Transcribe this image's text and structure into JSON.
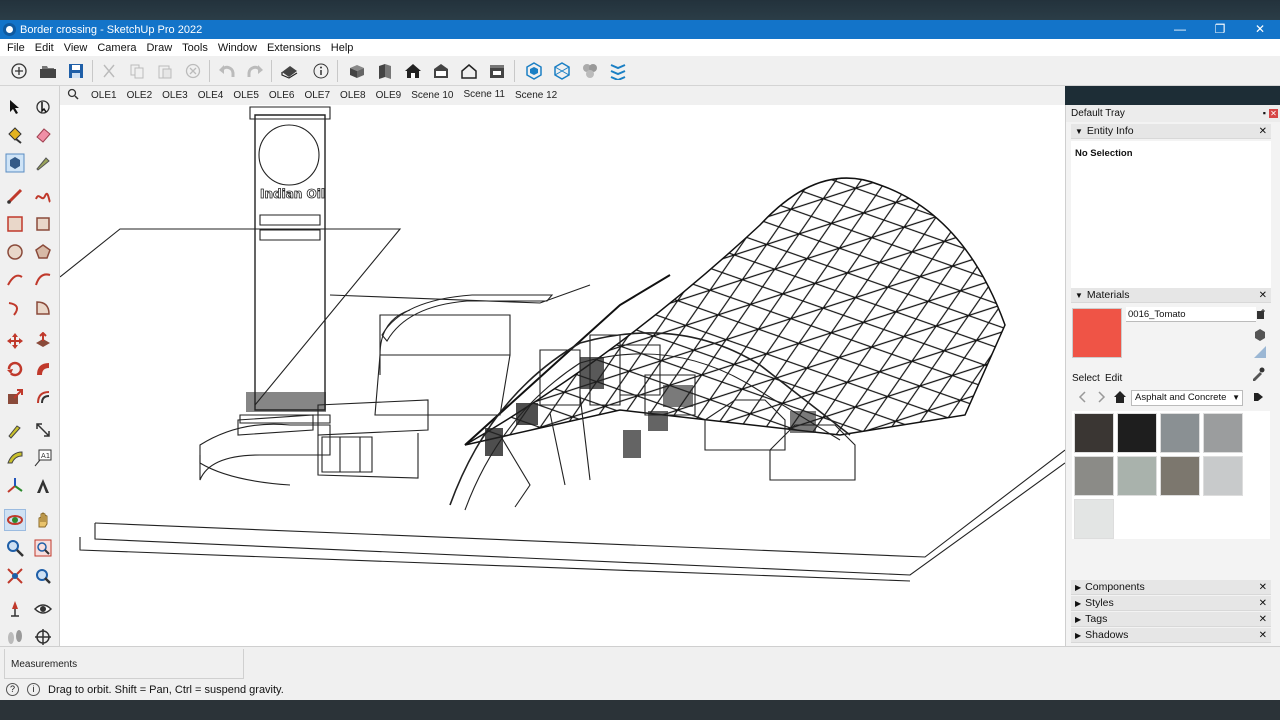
{
  "window": {
    "title": "Border crossing - SketchUp Pro 2022",
    "controls": [
      "—",
      "❐",
      "✕"
    ]
  },
  "menu": [
    "File",
    "Edit",
    "View",
    "Camera",
    "Draw",
    "Tools",
    "Window",
    "Extensions",
    "Help"
  ],
  "scenes": [
    "OLE1",
    "OLE2",
    "OLE3",
    "OLE4",
    "OLE5",
    "OLE6",
    "OLE7",
    "OLE8",
    "OLE9",
    "Scene 10",
    "Scene 11",
    "Scene 12"
  ],
  "model": {
    "sign_text": "Indian Oil"
  },
  "tray": {
    "title": "Default Tray",
    "entity_info": {
      "header": "Entity Info",
      "selection": "No Selection"
    },
    "materials": {
      "header": "Materials",
      "current": "0016_Tomato",
      "current_color": "#ef5446",
      "tab_select": "Select",
      "tab_edit": "Edit",
      "library": "Asphalt and Concrete",
      "swatch_colors": [
        "#3a3633",
        "#1e1e1e",
        "#8a9093",
        "#9b9d9e",
        "#8b8b87",
        "#a9b2ac",
        "#7c776e",
        "#c8cacb",
        "#e3e5e4"
      ]
    },
    "collapsed_panels": [
      "Components",
      "Styles",
      "Tags",
      "Shadows"
    ]
  },
  "status": {
    "measurements_label": "Measurements",
    "hint": "Drag to orbit. Shift = Pan, Ctrl = suspend gravity."
  }
}
